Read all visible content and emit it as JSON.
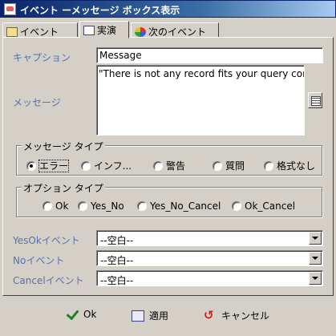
{
  "window": {
    "title": "イベント ーメッセージ ボックス表示"
  },
  "tabs": [
    {
      "label": "イベント",
      "icon": "event-icon"
    },
    {
      "label": "実演",
      "icon": "action-icon"
    },
    {
      "label": "次のイベント",
      "icon": "next-event-icon"
    }
  ],
  "form": {
    "caption_label": "キャプション",
    "caption_value": "Message",
    "message_label": "メッセージ",
    "message_value": "\"There is not any record fits your query condition"
  },
  "message_type": {
    "title": "メッセージ タイプ",
    "options": [
      "エラー",
      "インフ...",
      "警告",
      "質問",
      "格式なし"
    ],
    "selected": "エラー"
  },
  "option_type": {
    "title": "オプション タイプ",
    "options": [
      "Ok",
      "Yes_No",
      "Yes_No_Cancel",
      "Ok_Cancel"
    ]
  },
  "events": [
    {
      "label": "YesOkイベント",
      "value": "--空白--"
    },
    {
      "label": "Noイベント",
      "value": "--空白--"
    },
    {
      "label": "Cancelイベント",
      "value": "--空白--"
    }
  ],
  "footer": {
    "ok": "Ok",
    "apply": "適用",
    "cancel": "キャンセル"
  }
}
